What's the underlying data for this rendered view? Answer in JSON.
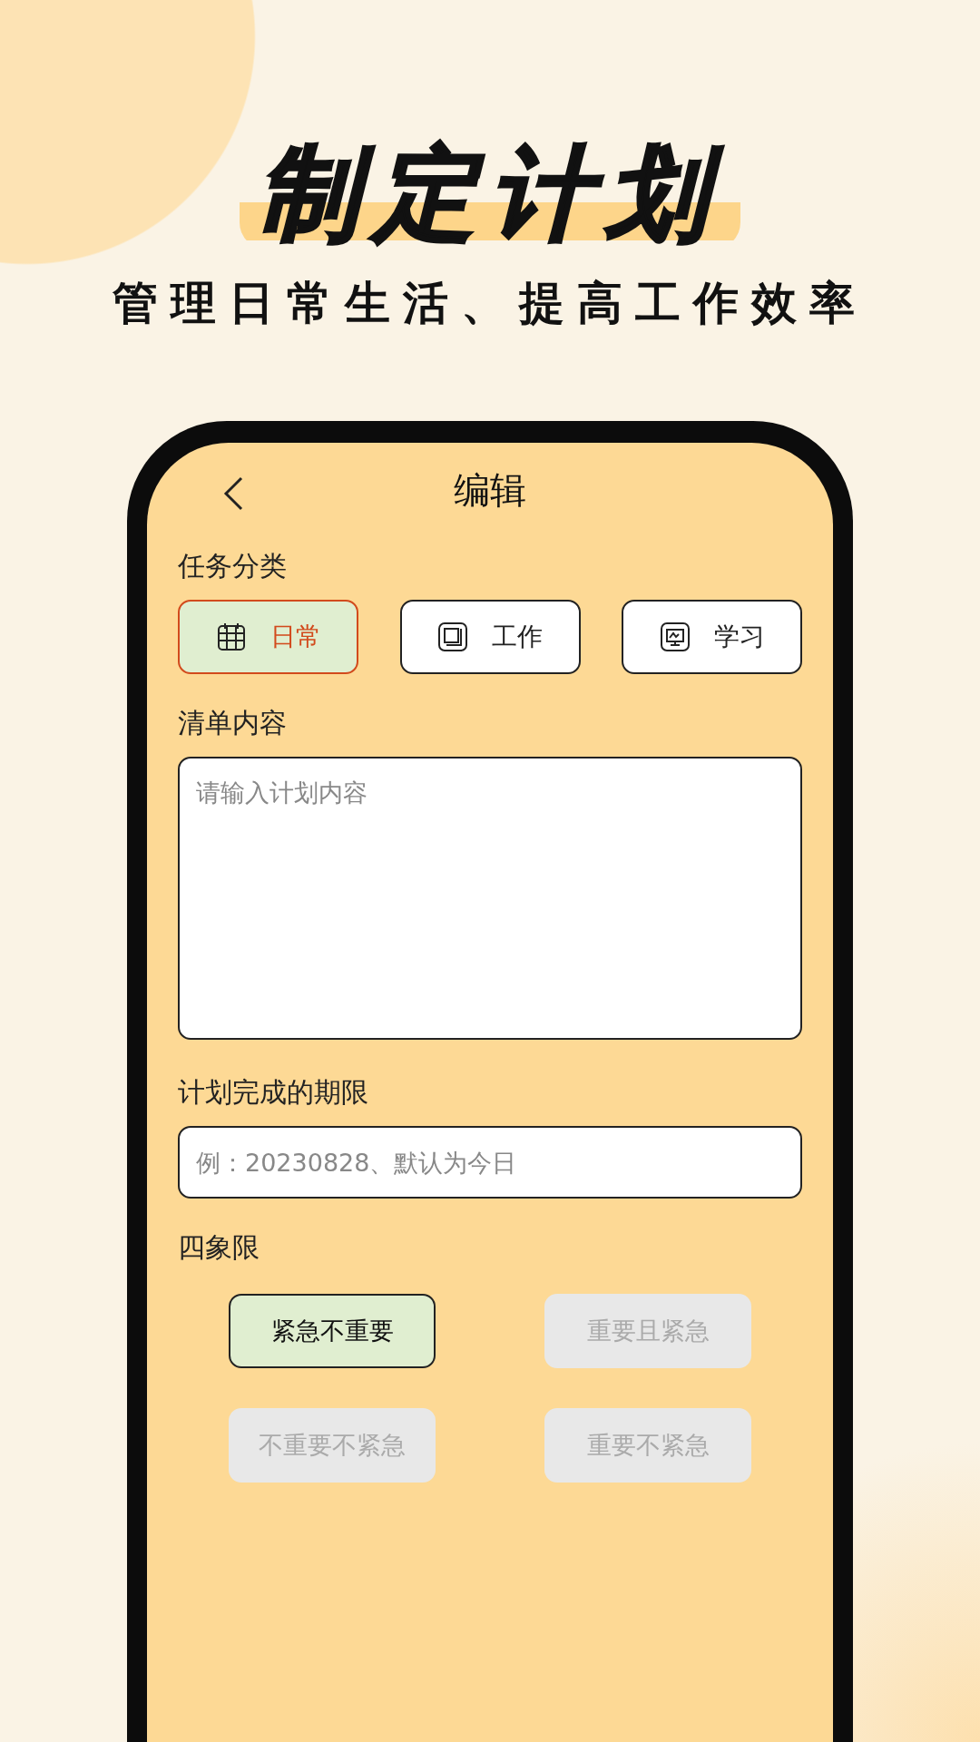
{
  "headline": "制定计划",
  "subtitle": "管理日常生活、提高工作效率",
  "screen": {
    "title": "编辑",
    "category_label": "任务分类",
    "categories": [
      {
        "label": "日常",
        "selected": true
      },
      {
        "label": "工作",
        "selected": false
      },
      {
        "label": "学习",
        "selected": false
      }
    ],
    "content_label": "清单内容",
    "content_field": {
      "placeholder": "请输入计划内容"
    },
    "deadline_label": "计划完成的期限",
    "deadline_field": {
      "placeholder": "例：20230828、默认为今日"
    },
    "quadrant_label": "四象限",
    "quadrants": [
      {
        "label": "紧急不重要",
        "selected": true
      },
      {
        "label": "重要且紧急",
        "selected": false
      },
      {
        "label": "不重要不紧急",
        "selected": false
      },
      {
        "label": "重要不紧急",
        "selected": false
      }
    ]
  }
}
